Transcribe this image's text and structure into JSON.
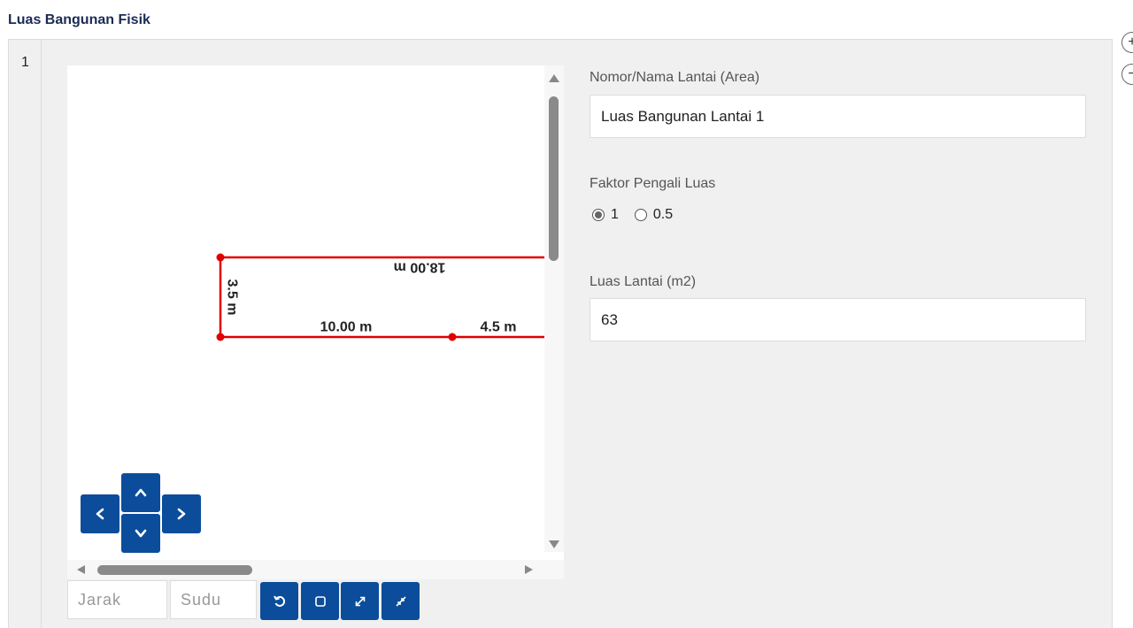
{
  "section": {
    "title": "Luas Bangunan Fisik"
  },
  "row": {
    "number": "1"
  },
  "drawing": {
    "line_color": "#e00000",
    "labels": {
      "top": "18.00 m",
      "left": "3.5 m",
      "bottom_left": "10.00 m",
      "bottom_right": "4.5 m"
    }
  },
  "navigation": {
    "up_icon": "chevron-up-icon",
    "down_icon": "chevron-down-icon",
    "left_icon": "chevron-left-icon",
    "right_icon": "chevron-right-icon"
  },
  "toolbar": {
    "distance_placeholder": "Jarak",
    "angle_placeholder": "Sudu",
    "buttons": [
      "undo-icon",
      "square-icon",
      "expand-icon",
      "collapse-icon"
    ]
  },
  "form": {
    "floor_name_label": "Nomor/Nama Lantai (Area)",
    "floor_name_value": "Luas Bangunan Lantai 1",
    "multiplier_label": "Faktor Pengali Luas",
    "multiplier_options": [
      "1",
      "0.5"
    ],
    "multiplier_selected": "1",
    "floor_area_label": "Luas Lantai (m2)",
    "floor_area_value": "63"
  },
  "side_controls": {
    "add": "+",
    "remove": "−"
  },
  "colors": {
    "accent": "#0b4d9b",
    "title": "#1c2a55",
    "drawing_line": "#e00000"
  }
}
